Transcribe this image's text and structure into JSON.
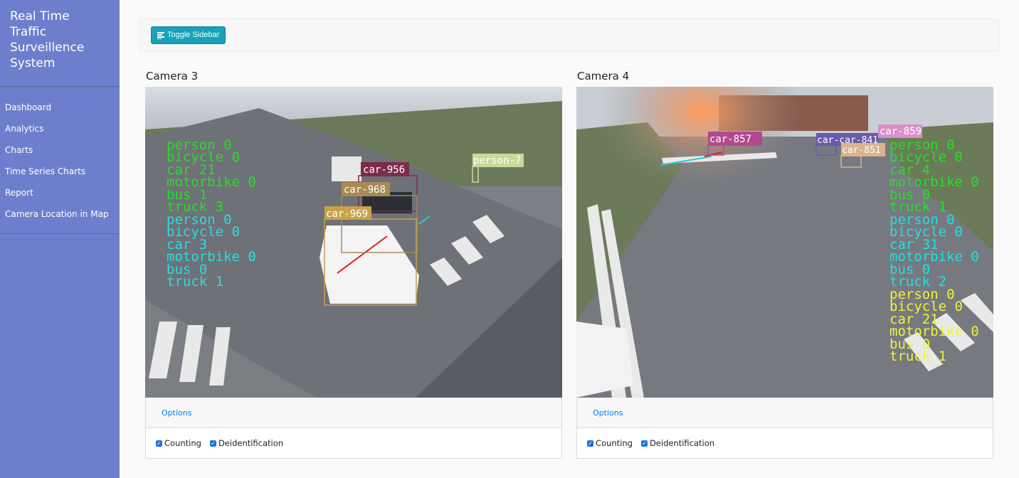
{
  "sidebar": {
    "brand": "Real Time Traffic Surveillence System",
    "items": [
      {
        "label": "Dashboard"
      },
      {
        "label": "Analytics"
      },
      {
        "label": "Charts"
      },
      {
        "label": "Time Series Charts"
      },
      {
        "label": "Report"
      },
      {
        "label": "Camera Location in Map"
      }
    ]
  },
  "topbar": {
    "toggle_label": "Toggle Sidebar",
    "toggle_icon": "align-left-icon"
  },
  "cameras": [
    {
      "title": "Camera 3",
      "options_label": "Options",
      "counting_label": "Counting",
      "deid_label": "Deidentification",
      "counting_checked": true,
      "deid_checked": true,
      "boxes": [
        {
          "label": "car-956",
          "color": "#7b2d4b"
        },
        {
          "label": "car-968",
          "color": "#a88a52"
        },
        {
          "label": "car-969",
          "color": "#c8a24b"
        },
        {
          "label": "person-7",
          "color": "#c9d99a"
        }
      ],
      "counts": [
        {
          "color": "#25e025",
          "lines": [
            "person 0",
            "bicycle 0",
            "car 21",
            "motorbike 0",
            "bus 1",
            "truck 3"
          ]
        },
        {
          "color": "#22e0e0",
          "lines": [
            "person 0",
            "bicycle 0",
            "car 3",
            "motorbike 0",
            "bus 0",
            "truck 1"
          ]
        }
      ]
    },
    {
      "title": "Camera 4",
      "options_label": "Options",
      "counting_label": "Counting",
      "deid_label": "Deidentification",
      "counting_checked": true,
      "deid_checked": true,
      "boxes": [
        {
          "label": "car-857",
          "color": "#b04a8f"
        },
        {
          "label": "car-car-841",
          "color": "#6a5aa8"
        },
        {
          "label": "car-859",
          "color": "#d98fc9"
        },
        {
          "label": "car-851",
          "color": "#d9b48a"
        }
      ],
      "counts": [
        {
          "color": "#25e025",
          "lines": [
            "person 0",
            "bicycle 0",
            "car 4",
            "motorbike 0",
            "bus 0",
            "truck 1"
          ]
        },
        {
          "color": "#22e0e0",
          "lines": [
            "person 0",
            "bicycle 0",
            "car 31",
            "motorbike 0",
            "bus 0",
            "truck 2"
          ]
        },
        {
          "color": "#f2f23a",
          "lines": [
            "person 0",
            "bicycle 0",
            "car 21",
            "motorbike 0",
            "bus 0",
            "truck 1"
          ]
        }
      ]
    }
  ]
}
